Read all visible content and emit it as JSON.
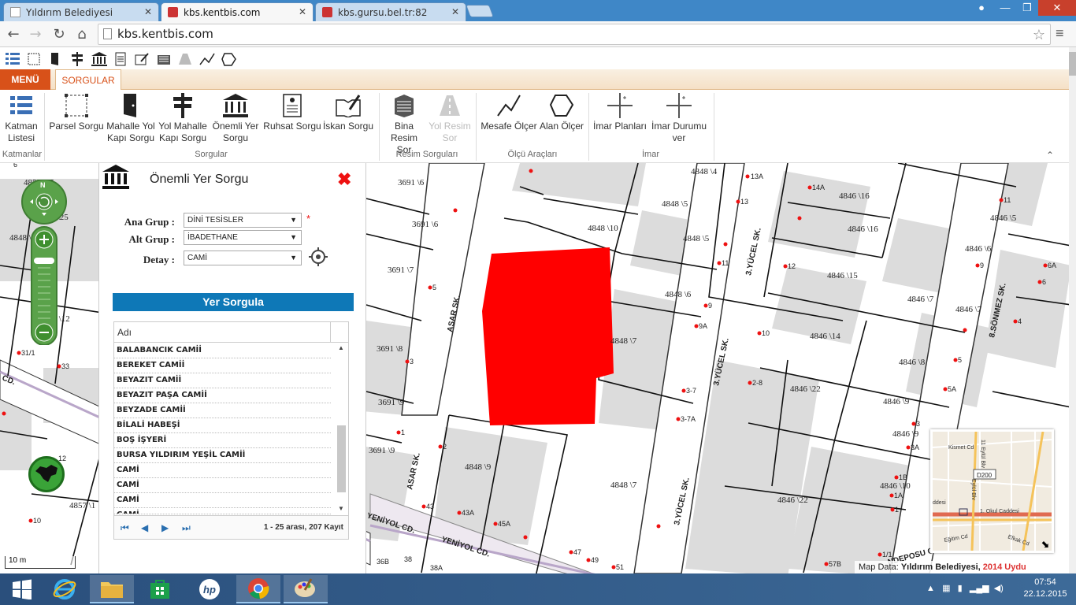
{
  "browser": {
    "tabs": [
      {
        "label": "Yıldırım Belediyesi",
        "active": false
      },
      {
        "label": "kbs.kentbis.com",
        "active": true
      },
      {
        "label": "kbs.gursu.bel.tr:82",
        "active": false
      }
    ],
    "url": "kbs.kentbis.com"
  },
  "ribbon": {
    "menu_tab": "MENÜ",
    "sorgular_tab": "SORGULAR",
    "buttons": {
      "katman": "Katman Listesi",
      "parsel": "Parsel Sorgu",
      "mahalle_yol": "Mahalle Yol Kapı Sorgu",
      "yol_mahalle": "Yol Mahalle Kapı Sorgu",
      "onemli_yer": "Önemli Yer Sorgu",
      "ruhsat": "Ruhsat Sorgu",
      "iskan": "İskan Sorgu",
      "bina_resim": "Bina Resim Sor",
      "yol_resim": "Yol Resim Sor",
      "mesafe": "Mesafe Ölçer",
      "alan": "Alan Ölçer",
      "imar_planlari": "İmar Planları",
      "imar_durumu": "İmar Durumu ver"
    },
    "groups": {
      "katmanlar": "Katmanlar",
      "sorgular": "Sorgular",
      "resim": "Resim Sorguları",
      "olcu": "Ölçü Araçları",
      "imar": "İmar"
    }
  },
  "panel": {
    "title": "Önemli Yer Sorgu",
    "fields": {
      "ana_grup_label": "Ana Grup :",
      "ana_grup_value": "DİNİ TESİSLER",
      "alt_grup_label": "Alt Grup :",
      "alt_grup_value": "İBADETHANE",
      "detay_label": "Detay :",
      "detay_value": "CAMİ",
      "required": "*"
    },
    "search_button": "Yer Sorgula",
    "grid": {
      "column": "Adı",
      "rows": [
        "BALABANCIK CAMİİ",
        "BEREKET CAMİİ",
        "BEYAZIT CAMİİ",
        "BEYAZIT PAŞA CAMİİ",
        "BEYZADE CAMİİ",
        "BİLALİ HABEŞİ",
        "BOŞ İŞYERİ",
        "BURSA YILDIRIM YEŞİL CAMİİ",
        "CAMİ",
        "CAMİ",
        "CAMİ",
        "CAMİ"
      ],
      "page_info": "1 - 25 arası, 207 Kayıt"
    }
  },
  "map": {
    "parcels": [
      "3691 \\6",
      "3691 \\6",
      "3691 \\7",
      "3691 \\8",
      "3691 \\9",
      "3691 \\9",
      "4848 \\4",
      "4848 \\5",
      "4848 \\5",
      "4848 \\10",
      "4848 \\6",
      "4848 \\7",
      "4848 \\9",
      "4848 \\7",
      "4846 \\16",
      "4846 \\16",
      "4846 \\6",
      "4846 \\5",
      "4846 \\15",
      "4846 \\7",
      "4846 \\7",
      "4846 \\14",
      "4846 \\8",
      "4846 \\22",
      "4846 \\9",
      "4846 \\9",
      "4846 \\10",
      "4846 \\22",
      "4855 \\25",
      "4855 \\25",
      "4855 \\12",
      "4857 \\1",
      "4848 \\10"
    ],
    "door_numbers": [
      "13A",
      "13",
      "11",
      "9",
      "9A",
      "10",
      "5",
      "3",
      "1",
      "2",
      "43",
      "43A",
      "45A",
      "47",
      "49",
      "51",
      "3-7",
      "3-7A",
      "2-8",
      "12",
      "14A",
      "11",
      "9",
      "6A",
      "6",
      "4",
      "5",
      "5A",
      "3",
      "3A",
      "1B",
      "1A",
      "1",
      "1/1",
      "57B",
      "36B",
      "38",
      "38A",
      "31/1",
      "33",
      "12",
      "10",
      "6"
    ],
    "streets": [
      "ASAR SK.",
      "ASAR SK.",
      "3.YÜCEL SK.",
      "3.YÜCEL SK.",
      "3.YÜCEL SK.",
      "8.SÖNMEZ SK.",
      "YENİYOL CD.",
      "YENİYOL CD.",
      "CD.",
      "NDEPOSU C"
    ],
    "scale": "10 m",
    "attribution_prefix": "Map Data: ",
    "attribution_owner": "Yıldırım Belediyesi,",
    "attribution_year": "2014 Uydu",
    "minimap_labels": [
      "Kismet Cd",
      "D200",
      "1. Okul Caddesi",
      "Eğitim Cd",
      "Efkak Cd",
      "11 Eylül Blv",
      "Eylül Blv",
      "ddesi"
    ],
    "zoom_compass": "N"
  },
  "taskbar": {
    "time": "07:54",
    "date": "22.12.2015"
  }
}
